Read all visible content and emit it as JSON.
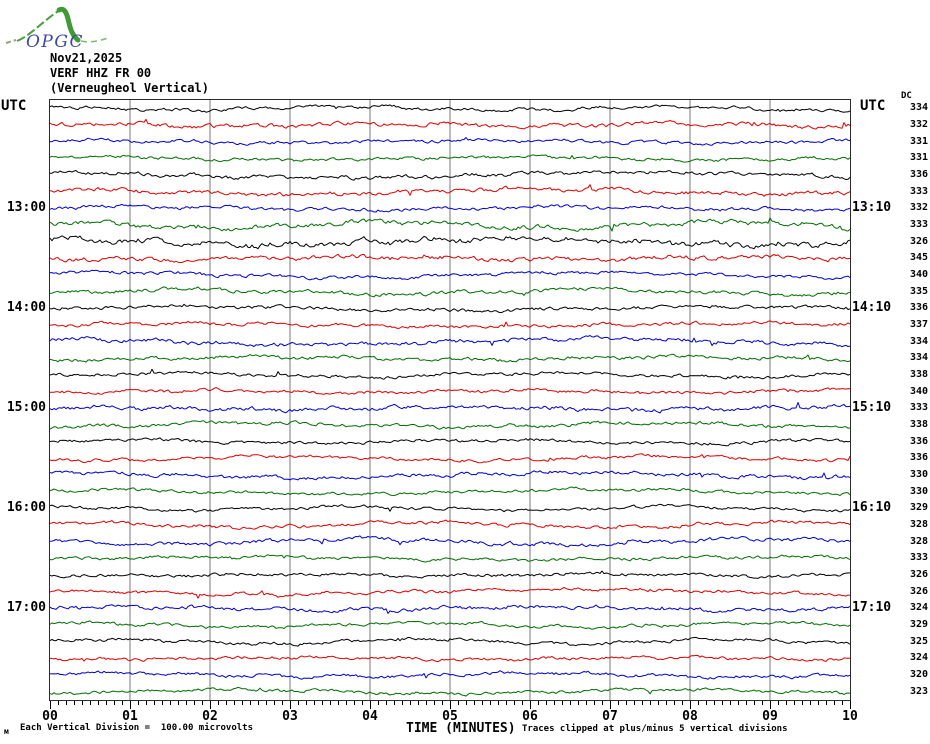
{
  "logo": {
    "text": "OPGC"
  },
  "header": {
    "date": "Nov21,2025",
    "station": "VERF HHZ FR 00",
    "description": "(Verneugheol Vertical)"
  },
  "axis": {
    "left_label": "UTC",
    "right_label": "UTC",
    "dc_label": "DC",
    "x_tick_labels": [
      "00",
      "01",
      "02",
      "03",
      "04",
      "05",
      "06",
      "07",
      "08",
      "09",
      "10"
    ],
    "xlabel": "TIME (MINUTES)"
  },
  "footer": {
    "mark": "м",
    "scale_note": "Each Vertical Division =  100.00 microvolts",
    "clip_note": "Traces clipped at plus/minus 5 vertical divisions"
  },
  "palette": {
    "black": "#000000",
    "red": "#dd0000",
    "blue": "#0000cc",
    "green": "#006e00",
    "grid": "#777777",
    "logo_green": "#3f9a37",
    "logo_text": "#3a4a9a"
  },
  "chart_data": {
    "type": "line",
    "subtype": "helicorder-seismogram",
    "title": "VERF HHZ FR 00 (Verneugheol Vertical) Nov21,2025",
    "xlabel": "TIME (MINUTES)",
    "x_range_minutes": [
      0,
      10
    ],
    "x_major_tick_labels": [
      "00",
      "01",
      "02",
      "03",
      "04",
      "05",
      "06",
      "07",
      "08",
      "09",
      "10"
    ],
    "x_minor_ticks_per_major": 10,
    "minutes_per_row": 10,
    "grid": "vertical-minute-lines",
    "notes": [
      "Each Vertical Division =  100.00 microvolts",
      "Traces clipped at plus/minus 5 vertical divisions"
    ],
    "traces": [
      {
        "color": "black",
        "dc": "334",
        "amp": 1.0
      },
      {
        "color": "red",
        "dc": "332",
        "amp": 1.3
      },
      {
        "color": "blue",
        "dc": "331",
        "amp": 1.0
      },
      {
        "color": "green",
        "dc": "331",
        "amp": 1.0
      },
      {
        "color": "black",
        "dc": "336",
        "amp": 1.2
      },
      {
        "color": "red",
        "dc": "333",
        "amp": 1.3
      },
      {
        "color": "blue",
        "dc": "332",
        "amp": 1.1,
        "utc_left": "13:00",
        "utc_right": "13:10"
      },
      {
        "color": "green",
        "dc": "333",
        "amp": 1.5
      },
      {
        "color": "black",
        "dc": "326",
        "amp": 1.8
      },
      {
        "color": "red",
        "dc": "345",
        "amp": 1.4
      },
      {
        "color": "blue",
        "dc": "340",
        "amp": 1.1
      },
      {
        "color": "green",
        "dc": "335",
        "amp": 1.2
      },
      {
        "color": "black",
        "dc": "336",
        "amp": 1.1,
        "utc_left": "14:00",
        "utc_right": "14:10"
      },
      {
        "color": "red",
        "dc": "337",
        "amp": 1.1
      },
      {
        "color": "blue",
        "dc": "334",
        "amp": 1.3
      },
      {
        "color": "green",
        "dc": "334",
        "amp": 1.1
      },
      {
        "color": "black",
        "dc": "338",
        "amp": 1.0
      },
      {
        "color": "red",
        "dc": "340",
        "amp": 1.1
      },
      {
        "color": "blue",
        "dc": "333",
        "amp": 1.3,
        "utc_left": "15:00",
        "utc_right": "15:10"
      },
      {
        "color": "green",
        "dc": "338",
        "amp": 1.1
      },
      {
        "color": "black",
        "dc": "336",
        "amp": 1.0
      },
      {
        "color": "red",
        "dc": "336",
        "amp": 1.0
      },
      {
        "color": "blue",
        "dc": "330",
        "amp": 1.2
      },
      {
        "color": "green",
        "dc": "330",
        "amp": 1.0
      },
      {
        "color": "black",
        "dc": "329",
        "amp": 1.0,
        "utc_left": "16:00",
        "utc_right": "16:10"
      },
      {
        "color": "red",
        "dc": "328",
        "amp": 1.1
      },
      {
        "color": "blue",
        "dc": "328",
        "amp": 1.2
      },
      {
        "color": "green",
        "dc": "333",
        "amp": 1.0
      },
      {
        "color": "black",
        "dc": "326",
        "amp": 1.0
      },
      {
        "color": "red",
        "dc": "326",
        "amp": 1.0
      },
      {
        "color": "blue",
        "dc": "324",
        "amp": 1.2,
        "utc_left": "17:00",
        "utc_right": "17:10"
      },
      {
        "color": "green",
        "dc": "329",
        "amp": 1.0
      },
      {
        "color": "black",
        "dc": "325",
        "amp": 1.0
      },
      {
        "color": "red",
        "dc": "324",
        "amp": 1.0
      },
      {
        "color": "blue",
        "dc": "320",
        "amp": 1.1
      },
      {
        "color": "green",
        "dc": "323",
        "amp": 1.0
      }
    ]
  }
}
